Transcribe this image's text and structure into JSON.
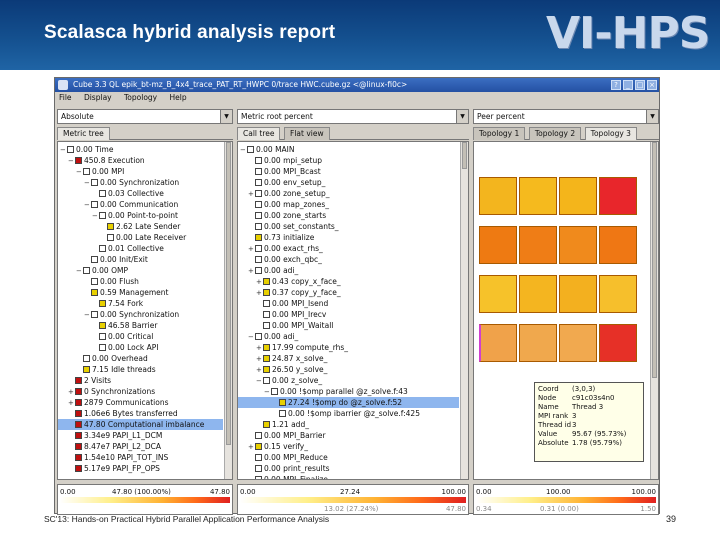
{
  "slide": {
    "title": "Scalasca hybrid analysis report",
    "brand": "VI-HPS",
    "footer": "SC'13: Hands-on Practical Hybrid Parallel Application Performance Analysis",
    "page": "39"
  },
  "window": {
    "title": "Cube 3.3 QL epik_bt-mz_B_4x4_trace_PAT_RT_HWPC 0/trace HWC.cube.gz <@linux-fi0c>",
    "menu": [
      "File",
      "Display",
      "Topology",
      "Help"
    ]
  },
  "metric_pane": {
    "combo": "Absolute",
    "tabs": [
      "Metric tree"
    ],
    "rows": [
      {
        "indent": 0,
        "exp": "−",
        "color": "#ffffff",
        "text": "0.00 Time"
      },
      {
        "indent": 1,
        "exp": "−",
        "color": "#c01010",
        "text": "450.8 Execution"
      },
      {
        "indent": 2,
        "exp": "−",
        "color": "#ffffff",
        "text": "0.00 MPI"
      },
      {
        "indent": 3,
        "exp": "−",
        "color": "#ffffff",
        "text": "0.00 Synchronization"
      },
      {
        "indent": 4,
        "exp": "",
        "color": "#ffffff",
        "text": "0.03 Collective"
      },
      {
        "indent": 3,
        "exp": "−",
        "color": "#ffffff",
        "text": "0.00 Communication"
      },
      {
        "indent": 4,
        "exp": "−",
        "color": "#ffffff",
        "text": "0.00 Point-to-point"
      },
      {
        "indent": 5,
        "exp": "",
        "color": "#e8d000",
        "text": "2.62 Late Sender"
      },
      {
        "indent": 5,
        "exp": "",
        "color": "#ffffff",
        "text": "0.00 Late Receiver"
      },
      {
        "indent": 4,
        "exp": "",
        "color": "#ffffff",
        "text": "0.01 Collective"
      },
      {
        "indent": 3,
        "exp": "",
        "color": "#ffffff",
        "text": "0.00 Init/Exit"
      },
      {
        "indent": 2,
        "exp": "−",
        "color": "#ffffff",
        "text": "0.00 OMP"
      },
      {
        "indent": 3,
        "exp": "",
        "color": "#ffffff",
        "text": "0.00 Flush"
      },
      {
        "indent": 3,
        "exp": "",
        "color": "#e8d000",
        "text": "0.59 Management"
      },
      {
        "indent": 4,
        "exp": "",
        "color": "#e8d000",
        "text": "7.54 Fork"
      },
      {
        "indent": 3,
        "exp": "−",
        "color": "#ffffff",
        "text": "0.00 Synchronization"
      },
      {
        "indent": 4,
        "exp": "",
        "color": "#e8d000",
        "text": "46.58 Barrier"
      },
      {
        "indent": 4,
        "exp": "",
        "color": "#ffffff",
        "text": "0.00 Critical"
      },
      {
        "indent": 4,
        "exp": "",
        "color": "#ffffff",
        "text": "0.00 Lock API"
      },
      {
        "indent": 2,
        "exp": "",
        "color": "#ffffff",
        "text": "0.00 Overhead"
      },
      {
        "indent": 2,
        "exp": "",
        "color": "#e8d000",
        "text": "7.15 Idle threads"
      },
      {
        "indent": 1,
        "exp": "",
        "color": "#c01010",
        "text": "2 Visits"
      },
      {
        "indent": 1,
        "exp": "+",
        "color": "#c01010",
        "text": "0 Synchronizations"
      },
      {
        "indent": 1,
        "exp": "+",
        "color": "#c01010",
        "text": "2879 Communications"
      },
      {
        "indent": 1,
        "exp": "",
        "color": "#c01010",
        "text": "1.06e6 Bytes transferred"
      },
      {
        "indent": 1,
        "exp": "",
        "color": "#c01010",
        "text": "47.80 Computational imbalance",
        "sel": true
      },
      {
        "indent": 1,
        "exp": "",
        "color": "#c01010",
        "text": "3.34e9 PAPI_L1_DCM"
      },
      {
        "indent": 1,
        "exp": "",
        "color": "#c01010",
        "text": "8.47e7 PAPI_L2_DCA"
      },
      {
        "indent": 1,
        "exp": "",
        "color": "#c01010",
        "text": "1.54e10 PAPI_TOT_INS"
      },
      {
        "indent": 1,
        "exp": "",
        "color": "#c01010",
        "text": "5.17e9 PAPI_FP_OPS"
      }
    ],
    "status": {
      "left": "0.00",
      "mid": "47.80 (100.00%)",
      "right": "47.80"
    }
  },
  "call_pane": {
    "combo": "Metric root percent",
    "tabs": [
      "Call tree",
      "Flat view"
    ],
    "rows": [
      {
        "indent": 0,
        "exp": "−",
        "color": "#ffffff",
        "text": "0.00 MAIN"
      },
      {
        "indent": 1,
        "exp": "",
        "color": "#ffffff",
        "text": "0.00 mpi_setup"
      },
      {
        "indent": 1,
        "exp": "",
        "color": "#ffffff",
        "text": "0.00 MPI_Bcast"
      },
      {
        "indent": 1,
        "exp": "",
        "color": "#ffffff",
        "text": "0.00 env_setup_"
      },
      {
        "indent": 1,
        "exp": "+",
        "color": "#ffffff",
        "text": "0.00 zone_setup_"
      },
      {
        "indent": 1,
        "exp": "",
        "color": "#ffffff",
        "text": "0.00 map_zones_"
      },
      {
        "indent": 1,
        "exp": "",
        "color": "#ffffff",
        "text": "0.00 zone_starts"
      },
      {
        "indent": 1,
        "exp": "",
        "color": "#ffffff",
        "text": "0.00 set_constants_"
      },
      {
        "indent": 1,
        "exp": "",
        "color": "#e8d000",
        "text": "0.73 initialize"
      },
      {
        "indent": 1,
        "exp": "+",
        "color": "#ffffff",
        "text": "0.00 exact_rhs_"
      },
      {
        "indent": 1,
        "exp": "",
        "color": "#ffffff",
        "text": "0.00 exch_qbc_"
      },
      {
        "indent": 1,
        "exp": "+",
        "color": "#ffffff",
        "text": "0.00 adi_"
      },
      {
        "indent": 2,
        "exp": "+",
        "color": "#e8d000",
        "text": "0.43 copy_x_face_"
      },
      {
        "indent": 2,
        "exp": "+",
        "color": "#e8d000",
        "text": "0.37 copy_y_face_"
      },
      {
        "indent": 2,
        "exp": "",
        "color": "#ffffff",
        "text": "0.00 MPI_Isend"
      },
      {
        "indent": 2,
        "exp": "",
        "color": "#ffffff",
        "text": "0.00 MPI_Irecv"
      },
      {
        "indent": 2,
        "exp": "",
        "color": "#ffffff",
        "text": "0.00 MPI_Waitall"
      },
      {
        "indent": 1,
        "exp": "−",
        "color": "#ffffff",
        "text": "0.00 adi_"
      },
      {
        "indent": 2,
        "exp": "+",
        "color": "#e8d000",
        "text": "17.99 compute_rhs_"
      },
      {
        "indent": 2,
        "exp": "+",
        "color": "#e8d000",
        "text": "24.87 x_solve_"
      },
      {
        "indent": 2,
        "exp": "+",
        "color": "#e8d000",
        "text": "26.50 y_solve_"
      },
      {
        "indent": 2,
        "exp": "−",
        "color": "#ffffff",
        "text": "0.00 z_solve_"
      },
      {
        "indent": 3,
        "exp": "−",
        "color": "#ffffff",
        "text": "0.00 !$omp parallel @z_solve.f:43"
      },
      {
        "indent": 4,
        "exp": "",
        "color": "#e8d000",
        "text": "27.24 !$omp do @z_solve.f:52",
        "sel": true
      },
      {
        "indent": 4,
        "exp": "",
        "color": "#ffffff",
        "text": "0.00 !$omp ibarrier @z_solve.f:425"
      },
      {
        "indent": 2,
        "exp": "",
        "color": "#e8d000",
        "text": "1.21 add_"
      },
      {
        "indent": 1,
        "exp": "",
        "color": "#ffffff",
        "text": "0.00 MPI_Barrier"
      },
      {
        "indent": 1,
        "exp": "+",
        "color": "#e8d000",
        "text": "0.15 verify_"
      },
      {
        "indent": 1,
        "exp": "",
        "color": "#ffffff",
        "text": "0.00 MPI_Reduce"
      },
      {
        "indent": 1,
        "exp": "",
        "color": "#ffffff",
        "text": "0.00 print_results"
      },
      {
        "indent": 1,
        "exp": "",
        "color": "#ffffff",
        "text": "0.00 MPI_Finalize"
      }
    ],
    "status": {
      "left": "0.00",
      "mid": "27.24",
      "mid2": "13.02 (27.24%)",
      "right": "100.00",
      "right2": "47.80"
    }
  },
  "topo_pane": {
    "combo": "Peer percent",
    "tabs": [
      "Topology 1",
      "Topology 2",
      "Topology 3"
    ],
    "colors": [
      [
        "#f3b51e",
        "#f5ba1e",
        "#f4b51b",
        "#e8262b"
      ],
      [
        "#ee7a12",
        "#ef7d16",
        "#f08a1c",
        "#ef7714"
      ],
      [
        "#f6c22a",
        "#f4b520",
        "#f3b01f",
        "#f6bf2c"
      ],
      [
        "#f0a24a",
        "#f0a84d",
        "#f1a94f",
        "#e63027"
      ]
    ],
    "tooltip": [
      {
        "k": "Coord",
        "v": "(3,0,3)"
      },
      {
        "k": "Node",
        "v": "c91c03s4n0"
      },
      {
        "k": "Name",
        "v": "Thread 3"
      },
      {
        "k": "MPI rank",
        "v": "3"
      },
      {
        "k": "Thread id",
        "v": "3"
      },
      {
        "k": "Value",
        "v": "95.67 (95.73%)"
      },
      {
        "k": "Absolute",
        "v": "1.78 (95.79%)"
      }
    ],
    "status": {
      "left": "0.00",
      "mid": "100.00",
      "mid2": "0.31 (0.00)",
      "right": "100.00",
      "l2": "0.34",
      "r2": "1.50"
    }
  }
}
